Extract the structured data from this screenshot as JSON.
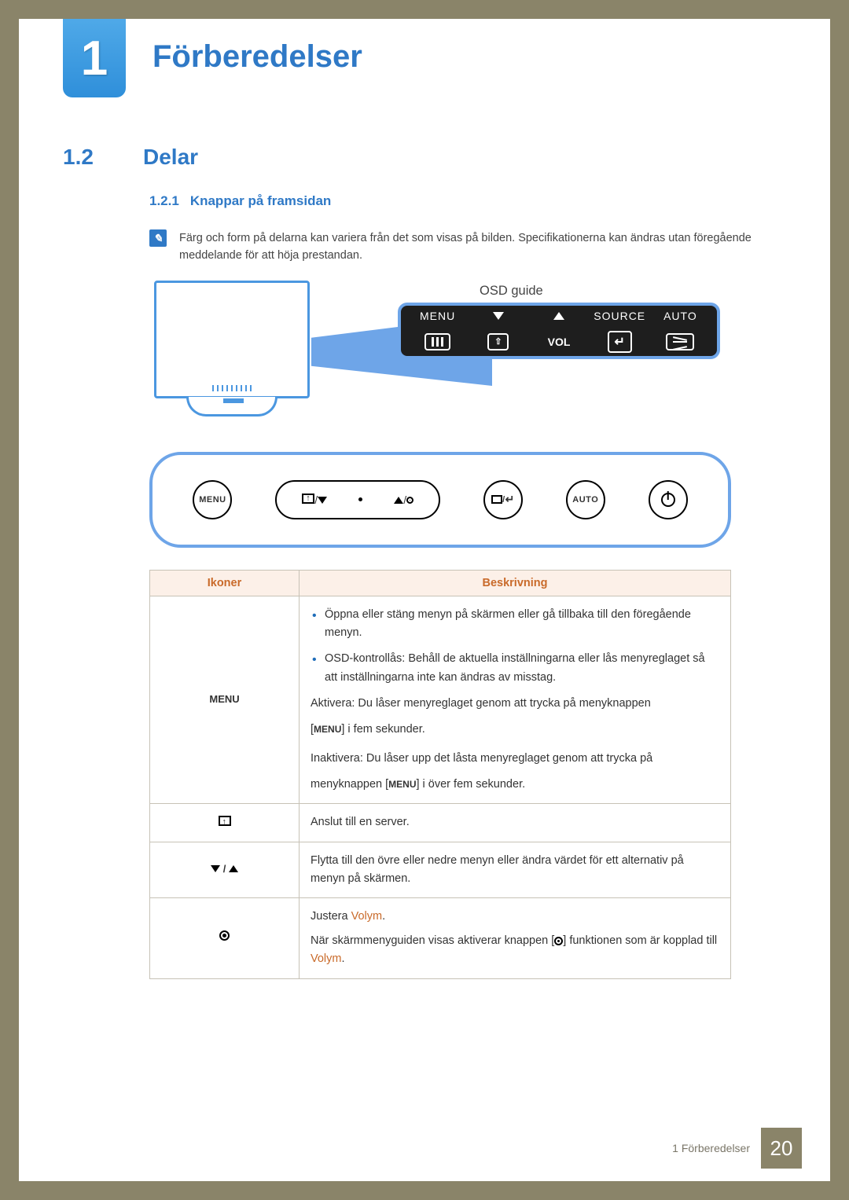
{
  "chapter": {
    "number": "1",
    "title": "Förberedelser"
  },
  "section": {
    "number": "1.2",
    "title": "Delar"
  },
  "subsection": {
    "number": "1.2.1",
    "title": "Knappar på framsidan"
  },
  "note": "Färg och form på delarna kan variera från det som visas på bilden. Specifikationerna kan ändras utan föregående meddelande för att höja prestandan.",
  "diagram": {
    "osd_label": "OSD guide",
    "osd_segments": {
      "menu": "MENU",
      "vol": "VOL",
      "source": "SOURCE",
      "auto": "AUTO"
    },
    "buttons": {
      "menu": "MENU",
      "auto": "AUTO"
    }
  },
  "table": {
    "headers": {
      "icons": "Ikoner",
      "desc": "Beskrivning"
    },
    "rows": {
      "menu": {
        "icon_text": "MENU",
        "b1": "Öppna eller stäng menyn på skärmen eller gå tillbaka till den föregående menyn.",
        "b2": "OSD-kontrollås: Behåll de aktuella inställningarna eller lås menyreglaget så att inställningarna inte kan ändras av misstag.",
        "p1a": "Aktivera: Du låser menyreglaget genom att trycka på menyknappen",
        "p1b_pre": "[",
        "p1b_menu": "MENU",
        "p1b_post": "] i fem sekunder.",
        "p2": "Inaktivera: Du låser upp det låsta menyreglaget genom att trycka på",
        "p3_pre": "menyknappen [",
        "p3_menu": "MENU",
        "p3_post": "] i över fem sekunder."
      },
      "connect": {
        "text": "Anslut till en server."
      },
      "arrows": {
        "text": "Flytta till den övre eller nedre menyn eller ändra värdet för ett alternativ på menyn på skärmen."
      },
      "vol": {
        "l1a": "Justera ",
        "l1b": "Volym",
        "l1c": ".",
        "l2a": "När skärmmenyguiden visas aktiverar knappen [",
        "l2b": "] funktionen som är kopplad till ",
        "l2c": "Volym",
        "l2d": "."
      }
    }
  },
  "footer": {
    "text": "1 Förberedelser",
    "page": "20"
  }
}
